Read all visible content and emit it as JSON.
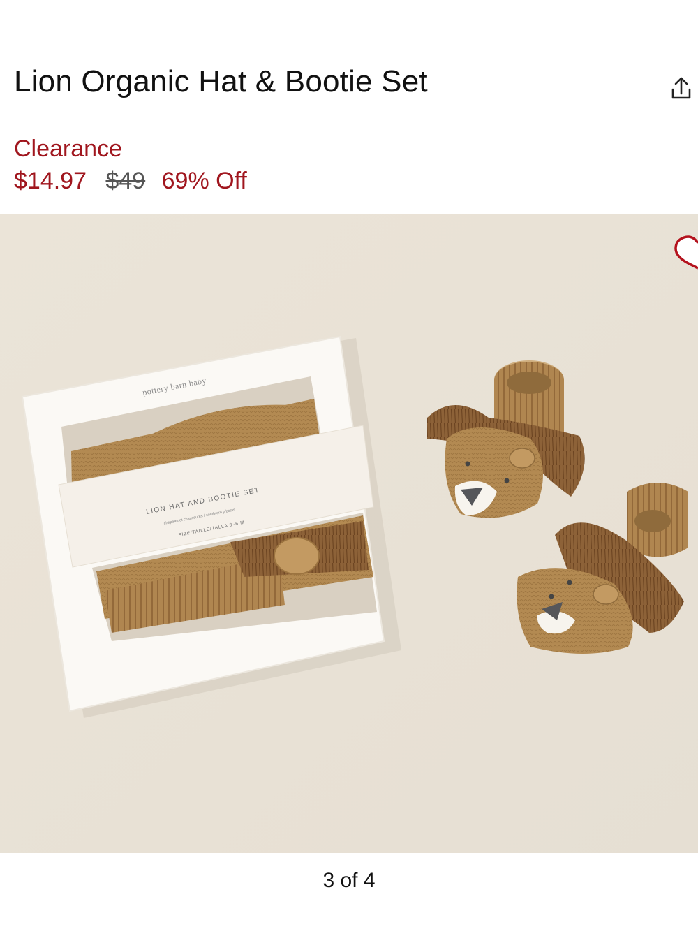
{
  "product": {
    "title": "Lion Organic Hat & Bootie Set",
    "badge": "Clearance",
    "sale_price": "$14.97",
    "original_price": "$49",
    "discount": "69% Off"
  },
  "gallery": {
    "counter": "3 of 4",
    "box_brand": "pottery barn baby",
    "box_label": "LION HAT AND BOOTIE SET",
    "box_sublabel": "chapeau et chaussures / sombrero y botas",
    "box_size": "SIZE/TAILLE/TALLA 3–6 M"
  },
  "icons": {
    "share": "share-icon",
    "favorite": "heart-icon"
  },
  "colors": {
    "sale_red": "#a0161e",
    "heart": "#b4121d",
    "backdrop": "#ece6dc",
    "knit": "#b38a52"
  }
}
